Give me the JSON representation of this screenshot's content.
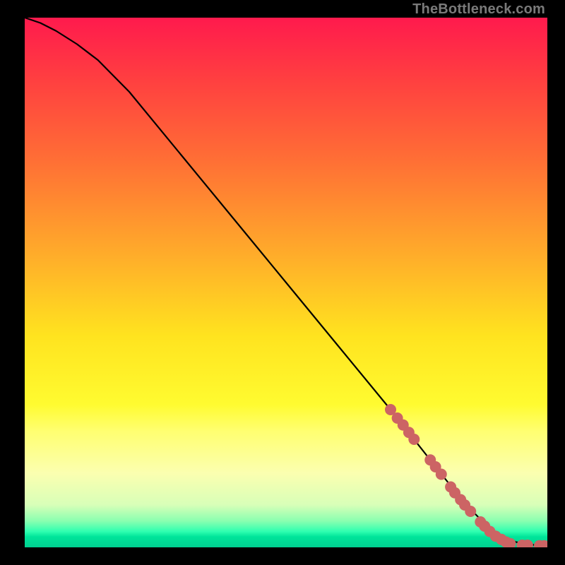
{
  "attribution": "TheBottleneck.com",
  "chart_data": {
    "type": "line",
    "title": "",
    "xlabel": "",
    "ylabel": "",
    "xlim": [
      0,
      100
    ],
    "ylim": [
      0,
      100
    ],
    "curve": {
      "name": "bottleneck-curve",
      "x": [
        0,
        3,
        6,
        10,
        14,
        20,
        30,
        40,
        50,
        60,
        70,
        78,
        82,
        85,
        88,
        90,
        92,
        94,
        96,
        98,
        100
      ],
      "y": [
        100,
        99,
        97.5,
        95,
        92,
        86,
        74,
        62,
        50,
        38,
        26,
        16,
        11,
        7.5,
        4.5,
        3.0,
        1.8,
        1.0,
        0.6,
        0.4,
        0.3
      ]
    },
    "markers": {
      "name": "highlighted-points",
      "color": "#cc6464",
      "radius_px": 8,
      "points": [
        {
          "x": 70.0,
          "y": 26.0
        },
        {
          "x": 71.3,
          "y": 24.4
        },
        {
          "x": 72.4,
          "y": 23.1
        },
        {
          "x": 73.5,
          "y": 21.7
        },
        {
          "x": 74.5,
          "y": 20.4
        },
        {
          "x": 77.6,
          "y": 16.5
        },
        {
          "x": 78.6,
          "y": 15.2
        },
        {
          "x": 79.7,
          "y": 13.8
        },
        {
          "x": 81.5,
          "y": 11.4
        },
        {
          "x": 82.3,
          "y": 10.3
        },
        {
          "x": 83.4,
          "y": 9.0
        },
        {
          "x": 84.2,
          "y": 8.0
        },
        {
          "x": 85.3,
          "y": 6.8
        },
        {
          "x": 87.2,
          "y": 4.8
        },
        {
          "x": 88.0,
          "y": 4.0
        },
        {
          "x": 89.0,
          "y": 3.0
        },
        {
          "x": 90.1,
          "y": 2.1
        },
        {
          "x": 91.2,
          "y": 1.5
        },
        {
          "x": 92.1,
          "y": 1.0
        },
        {
          "x": 92.9,
          "y": 0.7
        },
        {
          "x": 95.2,
          "y": 0.4
        },
        {
          "x": 96.2,
          "y": 0.4
        },
        {
          "x": 98.5,
          "y": 0.3
        },
        {
          "x": 99.4,
          "y": 0.3
        }
      ]
    },
    "gradient_stops": [
      {
        "pos": 0.0,
        "color": "#ff1a4d"
      },
      {
        "pos": 0.12,
        "color": "#ff4040"
      },
      {
        "pos": 0.27,
        "color": "#ff6f35"
      },
      {
        "pos": 0.45,
        "color": "#ffad2a"
      },
      {
        "pos": 0.6,
        "color": "#ffe31f"
      },
      {
        "pos": 0.73,
        "color": "#fffb30"
      },
      {
        "pos": 0.78,
        "color": "#ffff70"
      },
      {
        "pos": 0.86,
        "color": "#fbffb0"
      },
      {
        "pos": 0.92,
        "color": "#d8ffb8"
      },
      {
        "pos": 0.95,
        "color": "#8affb0"
      },
      {
        "pos": 0.97,
        "color": "#2fffb0"
      },
      {
        "pos": 0.98,
        "color": "#00e59a"
      },
      {
        "pos": 1.0,
        "color": "#00d090"
      }
    ]
  }
}
